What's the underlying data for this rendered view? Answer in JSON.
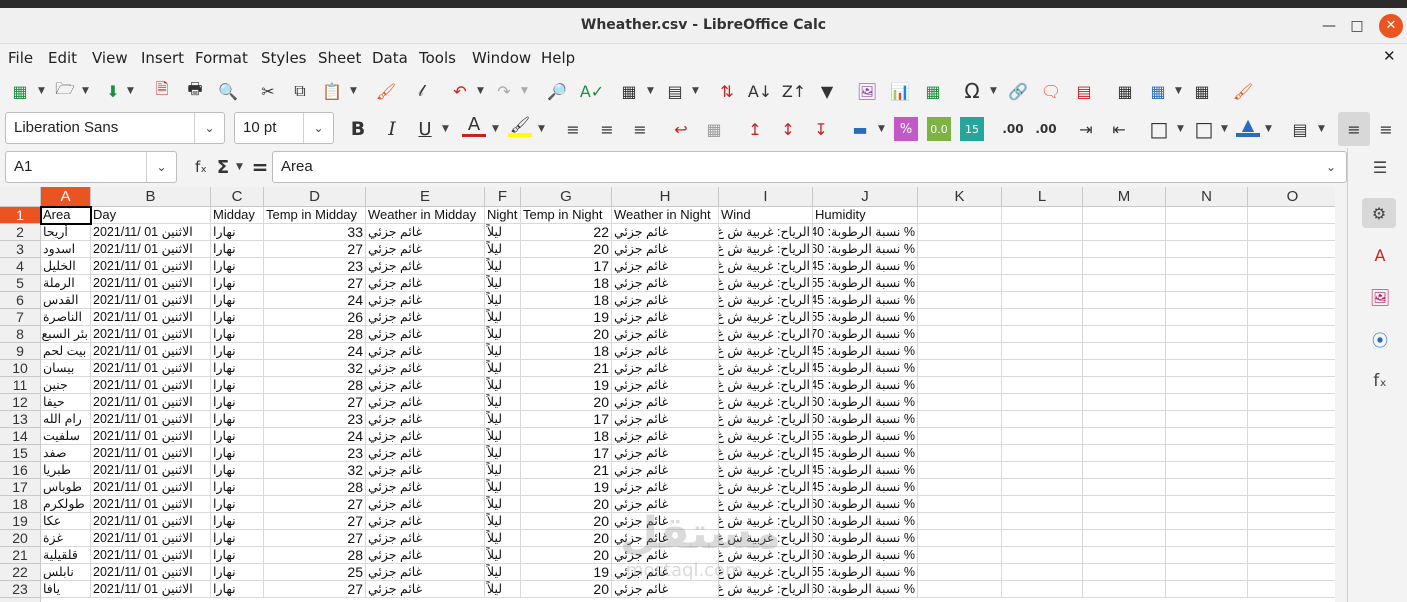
{
  "window": {
    "title": "Wheather.csv - LibreOffice Calc"
  },
  "menu": [
    "File",
    "Edit",
    "View",
    "Insert",
    "Format",
    "Styles",
    "Sheet",
    "Data",
    "Tools",
    "Window",
    "Help"
  ],
  "format": {
    "font_name": "Liberation Sans",
    "font_size": "10 pt"
  },
  "formula_bar": {
    "cell_ref": "A1",
    "content": "Area"
  },
  "columns": [
    "A",
    "B",
    "C",
    "D",
    "E",
    "F",
    "G",
    "H",
    "I",
    "J",
    "K",
    "L",
    "M",
    "N",
    "O"
  ],
  "header_row": [
    "Area",
    "Day",
    "Midday",
    "Temp in Midday",
    "Weather in Midday",
    "Night",
    "Temp in Night",
    "Weather in Night",
    "Wind",
    "Humidity"
  ],
  "rows": [
    {
      "n": "2",
      "area": "أريحا",
      "day": "الاثنين 01 /2021/11",
      "midday": "نهارا",
      "tmid": "33",
      "wmid": "غائم جزئي",
      "night": "ليلاً",
      "tnight": "22",
      "wnight": "غائم جزئي",
      "wind": "الرياح: غربية ش غ",
      "hum": "% نسبة الرطوبة: 40"
    },
    {
      "n": "3",
      "area": "اسدود",
      "day": "الاثنين 01 /2021/11",
      "midday": "نهارا",
      "tmid": "27",
      "wmid": "غائم جزئي",
      "night": "ليلاً",
      "tnight": "20",
      "wnight": "غائم جزئي",
      "wind": "الرياح: غربية ش غ",
      "hum": "% نسبة الرطوبة: 60"
    },
    {
      "n": "4",
      "area": "الخليل",
      "day": "الاثنين 01 /2021/11",
      "midday": "نهارا",
      "tmid": "23",
      "wmid": "غائم جزئي",
      "night": "ليلاً",
      "tnight": "17",
      "wnight": "غائم جزئي",
      "wind": "الرياح: غربية ش غ",
      "hum": "% نسبة الرطوبة: 45"
    },
    {
      "n": "5",
      "area": "الرملة",
      "day": "الاثنين 01 /2021/11",
      "midday": "نهارا",
      "tmid": "27",
      "wmid": "غائم جزئي",
      "night": "ليلاً",
      "tnight": "18",
      "wnight": "غائم جزئي",
      "wind": "الرياح: غربية ش غ",
      "hum": "% نسبة الرطوبة: 55"
    },
    {
      "n": "6",
      "area": "القدس",
      "day": "الاثنين 01 /2021/11",
      "midday": "نهارا",
      "tmid": "24",
      "wmid": "غائم جزئي",
      "night": "ليلاً",
      "tnight": "18",
      "wnight": "غائم جزئي",
      "wind": "الرياح: غربية ش غ",
      "hum": "% نسبة الرطوبة: 45"
    },
    {
      "n": "7",
      "area": "الناصرة",
      "day": "الاثنين 01 /2021/11",
      "midday": "نهارا",
      "tmid": "26",
      "wmid": "غائم جزئي",
      "night": "ليلاً",
      "tnight": "19",
      "wnight": "غائم جزئي",
      "wind": "الرياح: غربية ش غ",
      "hum": "% نسبة الرطوبة: 55"
    },
    {
      "n": "8",
      "area": "بئر السبع",
      "day": "الاثنين 01 /2021/11",
      "midday": "نهارا",
      "tmid": "28",
      "wmid": "غائم جزئي",
      "night": "ليلاً",
      "tnight": "20",
      "wnight": "غائم جزئي",
      "wind": "الرياح: غربية ش غ",
      "hum": "% نسبة الرطوبة: 70"
    },
    {
      "n": "9",
      "area": "بيت لحم",
      "day": "الاثنين 01 /2021/11",
      "midday": "نهارا",
      "tmid": "24",
      "wmid": "غائم جزئي",
      "night": "ليلاً",
      "tnight": "18",
      "wnight": "غائم جزئي",
      "wind": "الرياح: غربية ش غ",
      "hum": "% نسبة الرطوبة: 45"
    },
    {
      "n": "10",
      "area": "بيسان",
      "day": "الاثنين 01 /2021/11",
      "midday": "نهارا",
      "tmid": "32",
      "wmid": "غائم جزئي",
      "night": "ليلاً",
      "tnight": "21",
      "wnight": "غائم جزئي",
      "wind": "الرياح: غربية ش غ",
      "hum": "% نسبة الرطوبة: 45"
    },
    {
      "n": "11",
      "area": "جنين",
      "day": "الاثنين 01 /2021/11",
      "midday": "نهارا",
      "tmid": "28",
      "wmid": "غائم جزئي",
      "night": "ليلاً",
      "tnight": "19",
      "wnight": "غائم جزئي",
      "wind": "الرياح: غربية ش غ",
      "hum": "% نسبة الرطوبة: 45"
    },
    {
      "n": "12",
      "area": "حيفا",
      "day": "الاثنين 01 /2021/11",
      "midday": "نهارا",
      "tmid": "27",
      "wmid": "غائم جزئي",
      "night": "ليلاً",
      "tnight": "20",
      "wnight": "غائم جزئي",
      "wind": "الرياح: غربية ش غ",
      "hum": "% نسبة الرطوبة: 60"
    },
    {
      "n": "13",
      "area": "رام الله",
      "day": "الاثنين 01 /2021/11",
      "midday": "نهارا",
      "tmid": "23",
      "wmid": "غائم جزئي",
      "night": "ليلاً",
      "tnight": "17",
      "wnight": "غائم جزئي",
      "wind": "الرياح: غربية ش غ",
      "hum": "% نسبة الرطوبة: 50"
    },
    {
      "n": "14",
      "area": "سلفيت",
      "day": "الاثنين 01 /2021/11",
      "midday": "نهارا",
      "tmid": "24",
      "wmid": "غائم جزئي",
      "night": "ليلاً",
      "tnight": "18",
      "wnight": "غائم جزئي",
      "wind": "الرياح: غربية ش غ",
      "hum": "% نسبة الرطوبة: 55"
    },
    {
      "n": "15",
      "area": "صفد",
      "day": "الاثنين 01 /2021/11",
      "midday": "نهارا",
      "tmid": "23",
      "wmid": "غائم جزئي",
      "night": "ليلاً",
      "tnight": "17",
      "wnight": "غائم جزئي",
      "wind": "الرياح: غربية ش غ",
      "hum": "% نسبة الرطوبة: 45"
    },
    {
      "n": "16",
      "area": "طبريا",
      "day": "الاثنين 01 /2021/11",
      "midday": "نهارا",
      "tmid": "32",
      "wmid": "غائم جزئي",
      "night": "ليلاً",
      "tnight": "21",
      "wnight": "غائم جزئي",
      "wind": "الرياح: غربية ش غ",
      "hum": "% نسبة الرطوبة: 45"
    },
    {
      "n": "17",
      "area": "طوباس",
      "day": "الاثنين 01 /2021/11",
      "midday": "نهارا",
      "tmid": "28",
      "wmid": "غائم جزئي",
      "night": "ليلاً",
      "tnight": "19",
      "wnight": "غائم جزئي",
      "wind": "الرياح: غربية ش غ",
      "hum": "% نسبة الرطوبة: 45"
    },
    {
      "n": "18",
      "area": "طولكرم",
      "day": "الاثنين 01 /2021/11",
      "midday": "نهارا",
      "tmid": "27",
      "wmid": "غائم جزئي",
      "night": "ليلاً",
      "tnight": "20",
      "wnight": "غائم جزئي",
      "wind": "الرياح: غربية ش غ",
      "hum": "% نسبة الرطوبة: 60"
    },
    {
      "n": "19",
      "area": "عكا",
      "day": "الاثنين 01 /2021/11",
      "midday": "نهارا",
      "tmid": "27",
      "wmid": "غائم جزئي",
      "night": "ليلاً",
      "tnight": "20",
      "wnight": "غائم جزئي",
      "wind": "الرياح: غربية ش غ",
      "hum": "% نسبة الرطوبة: 60"
    },
    {
      "n": "20",
      "area": "غزة",
      "day": "الاثنين 01 /2021/11",
      "midday": "نهارا",
      "tmid": "27",
      "wmid": "غائم جزئي",
      "night": "ليلاً",
      "tnight": "20",
      "wnight": "غائم جزئي",
      "wind": "الرياح: غربية ش غ",
      "hum": "% نسبة الرطوبة: 60"
    },
    {
      "n": "21",
      "area": "قلقيلية",
      "day": "الاثنين 01 /2021/11",
      "midday": "نهارا",
      "tmid": "28",
      "wmid": "غائم جزئي",
      "night": "ليلاً",
      "tnight": "20",
      "wnight": "غائم جزئي",
      "wind": "الرياح: غربية ش غ",
      "hum": "% نسبة الرطوبة: 60"
    },
    {
      "n": "22",
      "area": "نابلس",
      "day": "الاثنين 01 /2021/11",
      "midday": "نهارا",
      "tmid": "25",
      "wmid": "غائم جزئي",
      "night": "ليلاً",
      "tnight": "19",
      "wnight": "غائم جزئي",
      "wind": "الرياح: غربية ش غ",
      "hum": "% نسبة الرطوبة: 55"
    },
    {
      "n": "23",
      "area": "يافا",
      "day": "الاثنين 01 /2021/11",
      "midday": "نهارا",
      "tmid": "27",
      "wmid": "غائم جزئي",
      "night": "ليلاً",
      "tnight": "20",
      "wnight": "غائم جزئي",
      "wind": "الرياح: غربية ش غ",
      "hum": "% نسبة الرطوبة: 60"
    }
  ],
  "watermark": {
    "ar": "مستقل",
    "en": "mostaql.com"
  },
  "colors": {
    "accent": "#e95420",
    "text_red": "#c9211e",
    "highlight_yellow": "#ffff00"
  }
}
